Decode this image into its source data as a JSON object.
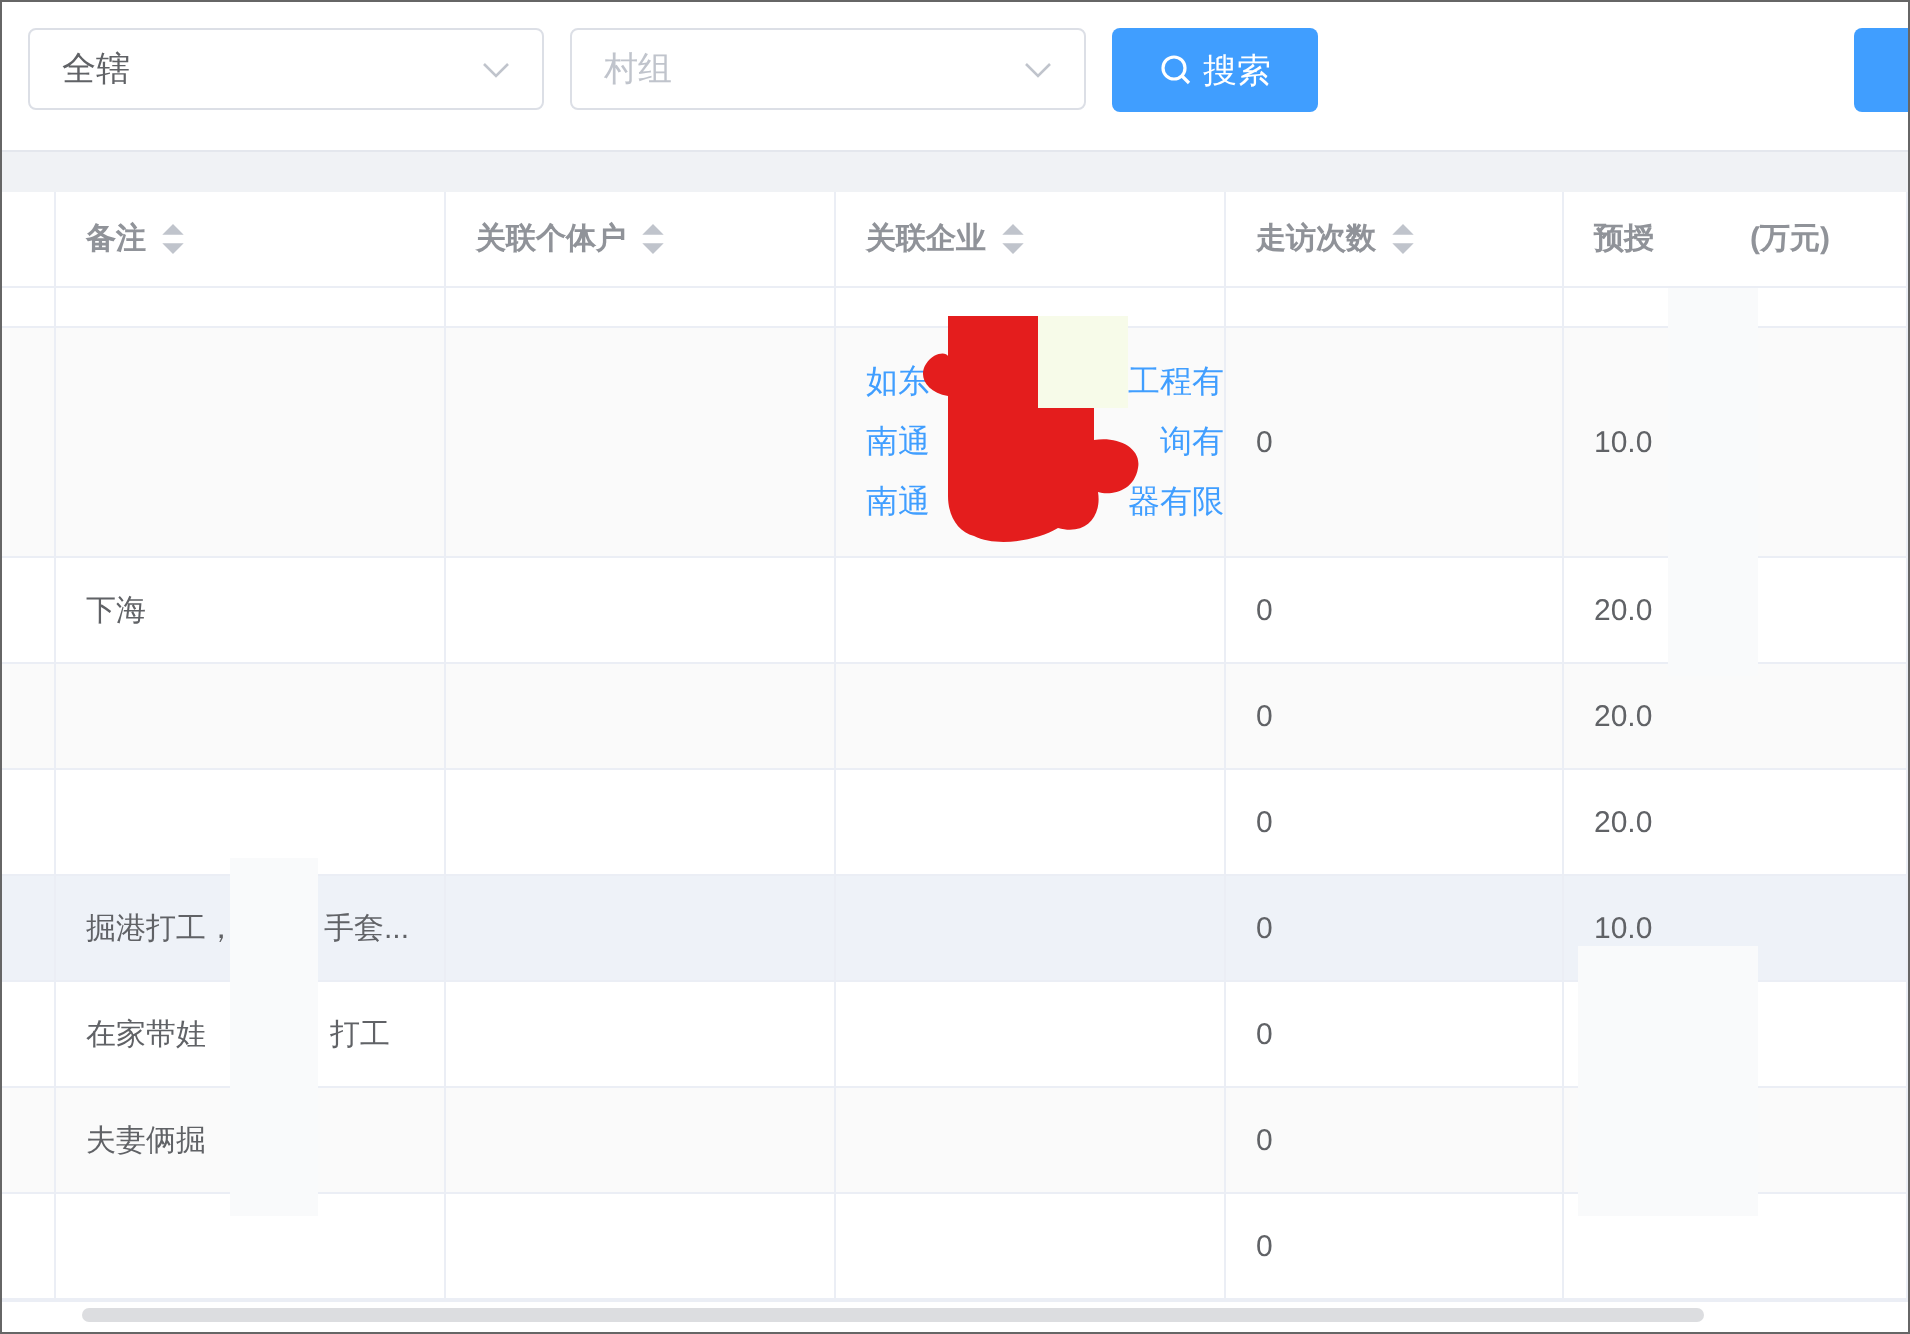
{
  "filters": [
    {
      "value": "全辖"
    },
    {
      "placeholder": "村组"
    }
  ],
  "search_button": {
    "label": "搜索"
  },
  "table": {
    "columns": [
      {
        "parts": [
          "备注"
        ],
        "sortable": true
      },
      {
        "parts": [
          "关联个体户"
        ],
        "sortable": true
      },
      {
        "parts": [
          "关联企业"
        ],
        "sortable": true
      },
      {
        "parts": [
          "走访次数"
        ],
        "sortable": true
      },
      {
        "parts": [
          "预授",
          "(万元)"
        ],
        "sortable": false
      }
    ],
    "rows": [
      {
        "hovered": false,
        "remark": [],
        "companies": [],
        "visits": "",
        "amount": ""
      },
      {
        "hovered": false,
        "remark": [],
        "companies": [
          [
            "如东",
            "工程有"
          ],
          [
            "南通",
            "询有"
          ],
          [
            "南通",
            "器有限"
          ]
        ],
        "visits": "0",
        "amount": "10.0"
      },
      {
        "hovered": false,
        "remark": [
          "下海"
        ],
        "companies": [],
        "visits": "0",
        "amount": "20.0"
      },
      {
        "hovered": false,
        "remark": [],
        "companies": [],
        "visits": "0",
        "amount": "20.0"
      },
      {
        "hovered": false,
        "remark": [],
        "companies": [],
        "visits": "0",
        "amount": "20.0"
      },
      {
        "hovered": true,
        "remark": [
          "掘港打工，",
          "手套..."
        ],
        "companies": [],
        "visits": "0",
        "amount": "10.0"
      },
      {
        "hovered": false,
        "remark": [
          "在家带娃",
          "打工"
        ],
        "companies": [],
        "visits": "0",
        "amount": ""
      },
      {
        "hovered": false,
        "remark": [
          "夫妻俩掘"
        ],
        "companies": [],
        "visits": "0",
        "amount": ""
      },
      {
        "hovered": false,
        "remark": [],
        "companies": [],
        "visits": "0",
        "amount": ""
      }
    ]
  }
}
